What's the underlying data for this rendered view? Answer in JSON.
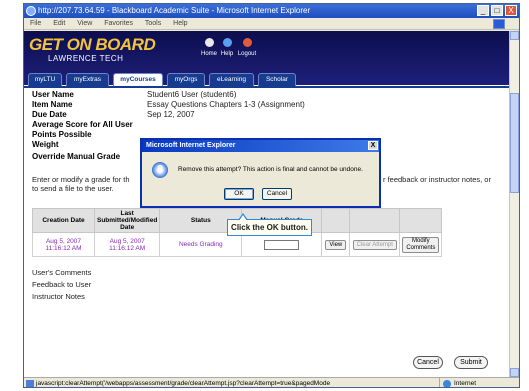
{
  "window": {
    "title": "http://207.73.64.59 - Blackboard Academic Suite - Microsoft Internet Explorer",
    "controls": {
      "minimize": "_",
      "maximize": "□",
      "close": "X"
    }
  },
  "menubar": {
    "items": [
      "File",
      "Edit",
      "View",
      "Favorites",
      "Tools",
      "Help"
    ]
  },
  "banner": {
    "logo_main": "GET ON BOARD",
    "logo_sub": "LAWRENCE TECH",
    "tools": [
      {
        "label": "Home",
        "icon": "home-icon"
      },
      {
        "label": "Help",
        "icon": "help-icon"
      },
      {
        "label": "Logout",
        "icon": "logout-icon"
      }
    ]
  },
  "tabs": [
    "myLTU",
    "myExtras",
    "myCourses",
    "myOrgs",
    "eLearning",
    "Scholar"
  ],
  "active_tab": "myCourses",
  "details": {
    "user_name_label": "User Name",
    "user_name_value": "Student6 User (student6)",
    "item_name_label": "Item Name",
    "item_name_value": "Essay Questions Chapters 1-3 (Assignment)",
    "due_date_label": "Due Date",
    "due_date_value": "Sep 12, 2007",
    "avg_score_label": "Average Score for All User",
    "points_possible_label": "Points Possible",
    "weight_label": "Weight",
    "override_label": "Override Manual Grade"
  },
  "instructions": {
    "left": "Enter or modify a grade for th",
    "right": "r feedback or instructor notes, or",
    "line2": "to send a file to the user."
  },
  "table": {
    "headers": [
      "Creation Date",
      "Last Submitted/Modified Date",
      "Status",
      "Manual Grade",
      "",
      "",
      ""
    ],
    "row": {
      "creation_date": "Aug 5, 2007 11:16:12 AM",
      "modified_date": "Aug 5, 2007 11:16:12 AM",
      "status": "Needs Grading",
      "manual_grade": "",
      "view_label": "View",
      "clear_label": "Clear Attempt",
      "modify_label": "Modify Comments"
    }
  },
  "notes": [
    "User's Comments",
    "Feedback to User",
    "Instructor Notes"
  ],
  "buttons": {
    "cancel": "Cancel",
    "submit": "Submit"
  },
  "statusbar": {
    "url": "javascript:clearAttempt('/webapps/assessment/grade/clearAttempt.jsp?clearAttempt=true&pagedMode",
    "zone": "Internet"
  },
  "dialog": {
    "title": "Microsoft Internet Explorer",
    "message": "Remove this attempt? This action is final and cannot be undone.",
    "ok": "OK",
    "cancel": "Cancel",
    "close": "X"
  },
  "callout": {
    "text": "Click the OK button."
  }
}
